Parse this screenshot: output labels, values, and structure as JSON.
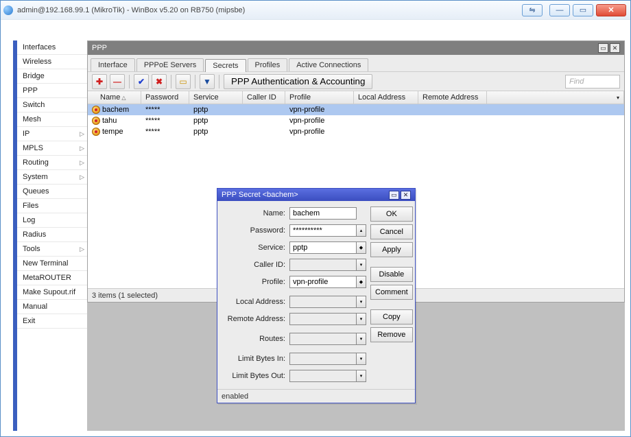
{
  "window": {
    "title": "admin@192.168.99.1 (MikroTik) - WinBox v5.20 on RB750 (mipsbe)"
  },
  "sidebar": {
    "items": [
      {
        "label": "Interfaces",
        "arrow": false
      },
      {
        "label": "Wireless",
        "arrow": false
      },
      {
        "label": "Bridge",
        "arrow": false
      },
      {
        "label": "PPP",
        "arrow": false
      },
      {
        "label": "Switch",
        "arrow": false
      },
      {
        "label": "Mesh",
        "arrow": false
      },
      {
        "label": "IP",
        "arrow": true
      },
      {
        "label": "MPLS",
        "arrow": true
      },
      {
        "label": "Routing",
        "arrow": true
      },
      {
        "label": "System",
        "arrow": true
      },
      {
        "label": "Queues",
        "arrow": false
      },
      {
        "label": "Files",
        "arrow": false
      },
      {
        "label": "Log",
        "arrow": false
      },
      {
        "label": "Radius",
        "arrow": false
      },
      {
        "label": "Tools",
        "arrow": true
      },
      {
        "label": "New Terminal",
        "arrow": false
      },
      {
        "label": "MetaROUTER",
        "arrow": false
      },
      {
        "label": "Make Supout.rif",
        "arrow": false
      },
      {
        "label": "Manual",
        "arrow": false
      },
      {
        "label": "Exit",
        "arrow": false
      }
    ]
  },
  "ppp": {
    "title": "PPP",
    "tabs": [
      "Interface",
      "PPPoE Servers",
      "Secrets",
      "Profiles",
      "Active Connections"
    ],
    "active_tab": 2,
    "auth_btn": "PPP Authentication & Accounting",
    "find_placeholder": "Find",
    "columns": [
      "Name",
      "Password",
      "Service",
      "Caller ID",
      "Profile",
      "Local Address",
      "Remote Address"
    ],
    "rows": [
      {
        "name": "bachem",
        "password": "*****",
        "service": "pptp",
        "caller_id": "",
        "profile": "vpn-profile",
        "local": "",
        "remote": "",
        "selected": true
      },
      {
        "name": "tahu",
        "password": "*****",
        "service": "pptp",
        "caller_id": "",
        "profile": "vpn-profile",
        "local": "",
        "remote": "",
        "selected": false
      },
      {
        "name": "tempe",
        "password": "*****",
        "service": "pptp",
        "caller_id": "",
        "profile": "vpn-profile",
        "local": "",
        "remote": "",
        "selected": false
      }
    ],
    "status": "3 items (1 selected)"
  },
  "dialog": {
    "title": "PPP Secret <bachem>",
    "fields": {
      "name_label": "Name:",
      "name_value": "bachem",
      "password_label": "Password:",
      "password_value": "**********",
      "service_label": "Service:",
      "service_value": "pptp",
      "caller_label": "Caller ID:",
      "caller_value": "",
      "profile_label": "Profile:",
      "profile_value": "vpn-profile",
      "local_label": "Local Address:",
      "local_value": "",
      "remote_label": "Remote Address:",
      "remote_value": "",
      "routes_label": "Routes:",
      "routes_value": "",
      "lbi_label": "Limit Bytes In:",
      "lbi_value": "",
      "lbo_label": "Limit Bytes Out:",
      "lbo_value": ""
    },
    "buttons": [
      "OK",
      "Cancel",
      "Apply",
      "Disable",
      "Comment",
      "Copy",
      "Remove"
    ],
    "status": "enabled"
  }
}
